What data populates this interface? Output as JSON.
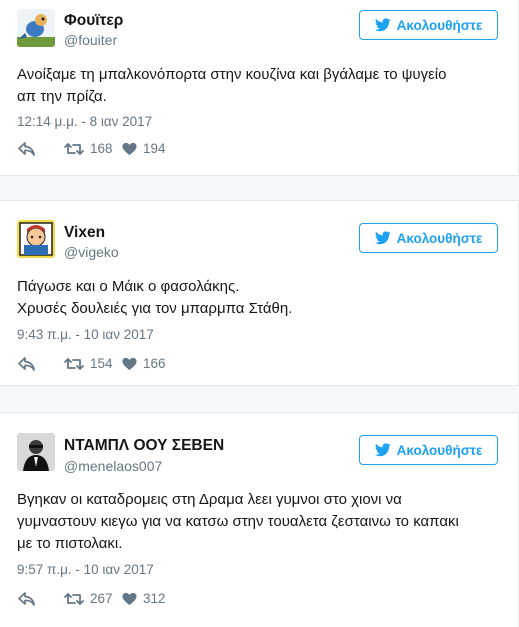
{
  "tweets": [
    {
      "name": "Φουϊτερ",
      "handle": "@fouiter",
      "follow_label": "Ακολουθήστε",
      "text_lines": [
        "Ανοίξαμε τη μπαλκονόπορτα στην κουζίνα και βγάλαμε το ψυγείο",
        "απ την πρίζα."
      ],
      "date": "12:14 μ.μ. - 8 ιαν 2017",
      "retweets": "168",
      "likes": "194"
    },
    {
      "name": "Vixen",
      "handle": "@vigeko",
      "follow_label": "Ακολουθήστε",
      "text_lines": [
        "Πάγωσε και ο Μάικ ο φασολάκης.",
        "Χρυσές δουλειές για τον μπαρμπα Στάθη."
      ],
      "date": "9:43 π.μ. - 10 ιαν 2017",
      "retweets": "154",
      "likes": "166"
    },
    {
      "name": "ΝΤΑΜΠΛ ΟΟΥ ΣΕΒΕΝ",
      "handle": "@menelaos007",
      "follow_label": "Ακολουθήστε",
      "text_lines": [
        "Βγηκαν οι καταδρομεις στη Δραμα λεει γυμνοι στο χιονι να",
        "γυμναστουν κιεγω για να κατσω στην τουαλετα ζεσταινω το καπακι",
        "με το πιστολακι."
      ],
      "date": "9:57 π.μ. - 10 ιαν 2017",
      "retweets": "267",
      "likes": "312"
    }
  ],
  "colors": {
    "accent": "#1da1f2",
    "muted": "#657786",
    "text": "#14171a"
  },
  "icons": [
    "twitter-bird-icon",
    "reply-icon",
    "retweet-icon",
    "heart-icon"
  ]
}
